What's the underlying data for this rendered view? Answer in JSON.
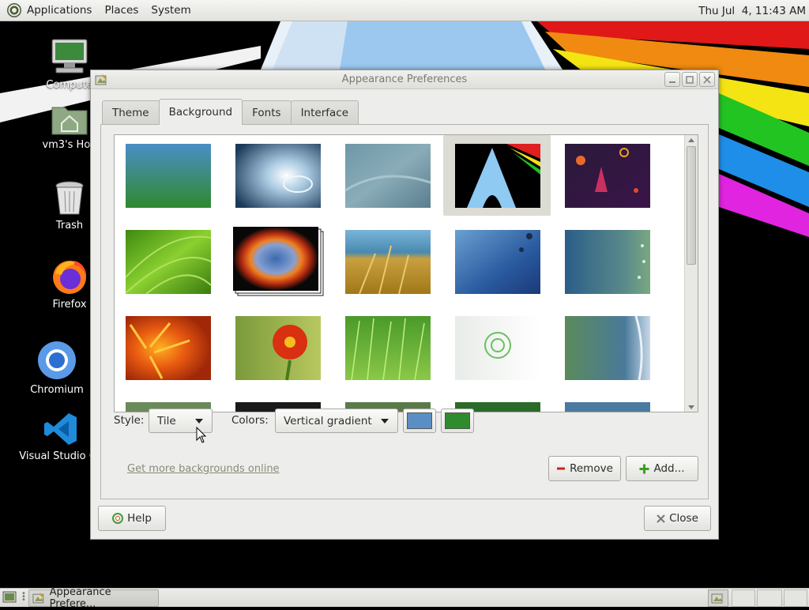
{
  "top_panel": {
    "menus": [
      "Applications",
      "Places",
      "System"
    ],
    "clock": "Thu Jul  4, 11:43 AM"
  },
  "desktop": {
    "icons": [
      {
        "label": "Compute",
        "icon": "computer-icon"
      },
      {
        "label": "vm3's Hon",
        "icon": "home-folder-icon"
      },
      {
        "label": "Trash",
        "icon": "trash-icon"
      },
      {
        "label": "Firefox",
        "icon": "firefox-icon"
      },
      {
        "label": "Chromium",
        "icon": "chromium-icon"
      },
      {
        "label": "Visual Studio Co",
        "icon": "vscode-icon"
      }
    ]
  },
  "window": {
    "title": "Appearance Preferences",
    "tabs": [
      "Theme",
      "Background",
      "Fonts",
      "Interface"
    ],
    "active_tab": "Background",
    "style_label": "Style:",
    "style_value": "Tile",
    "colors_label": "Colors:",
    "colors_value": "Vertical gradient",
    "primary_color": "#5b8ec4",
    "secondary_color": "#2e8b2e",
    "online_link": "Get more backgrounds online",
    "remove_label": "Remove",
    "add_label": "Add...",
    "help_label": "Help",
    "close_label": "Close",
    "selected_background_index": 3
  },
  "bottom_panel": {
    "task_label": "Appearance Prefere..."
  }
}
